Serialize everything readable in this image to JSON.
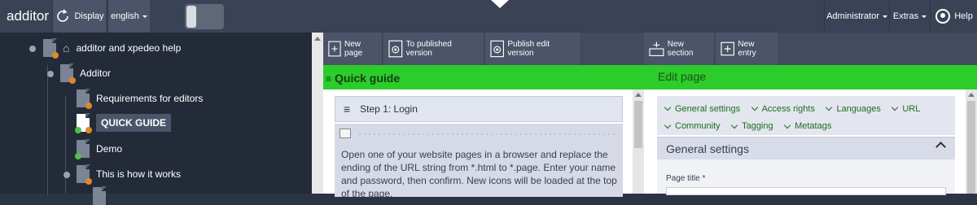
{
  "topbar": {
    "brand": "additor",
    "display_label": "Display",
    "language_label": "english",
    "admin_label": "Administrator",
    "extras_label": "Extras",
    "help_label": "Help"
  },
  "tree": {
    "items": [
      {
        "label": "additor and xpedeo help",
        "icon": "document-icon"
      },
      {
        "label": "Additor",
        "icon": "document-icon"
      },
      {
        "label": "Requirements for editors",
        "icon": "document-icon"
      },
      {
        "label": "QUICK GUIDE",
        "icon": "document-icon"
      },
      {
        "label": "Demo",
        "icon": "document-icon"
      },
      {
        "label": "This is how it works",
        "icon": "document-icon"
      }
    ]
  },
  "toolbar": {
    "new_page": "New page",
    "to_published": "To published version",
    "publish_edit": "Publish edit version",
    "new_section": "New section",
    "new_entry": "New entry"
  },
  "left_panel": {
    "title": "Quick guide",
    "step_title": "Step 1: Login",
    "body": "Open one of your website pages in a browser and replace the ending of the URL string from *.html to *.page. Enter your name and password, then confirm. New icons will be loaded at the top of the page."
  },
  "right_panel": {
    "title": "Edit page",
    "links": [
      "General settings",
      "Access rights",
      "Languages",
      "URL",
      "Community",
      "Tagging",
      "Metatags"
    ],
    "section_title": "General settings",
    "page_title_label": "Page title *"
  },
  "colors": {
    "accent_green": "#2ccc2a",
    "dark_bg": "#232b39"
  }
}
